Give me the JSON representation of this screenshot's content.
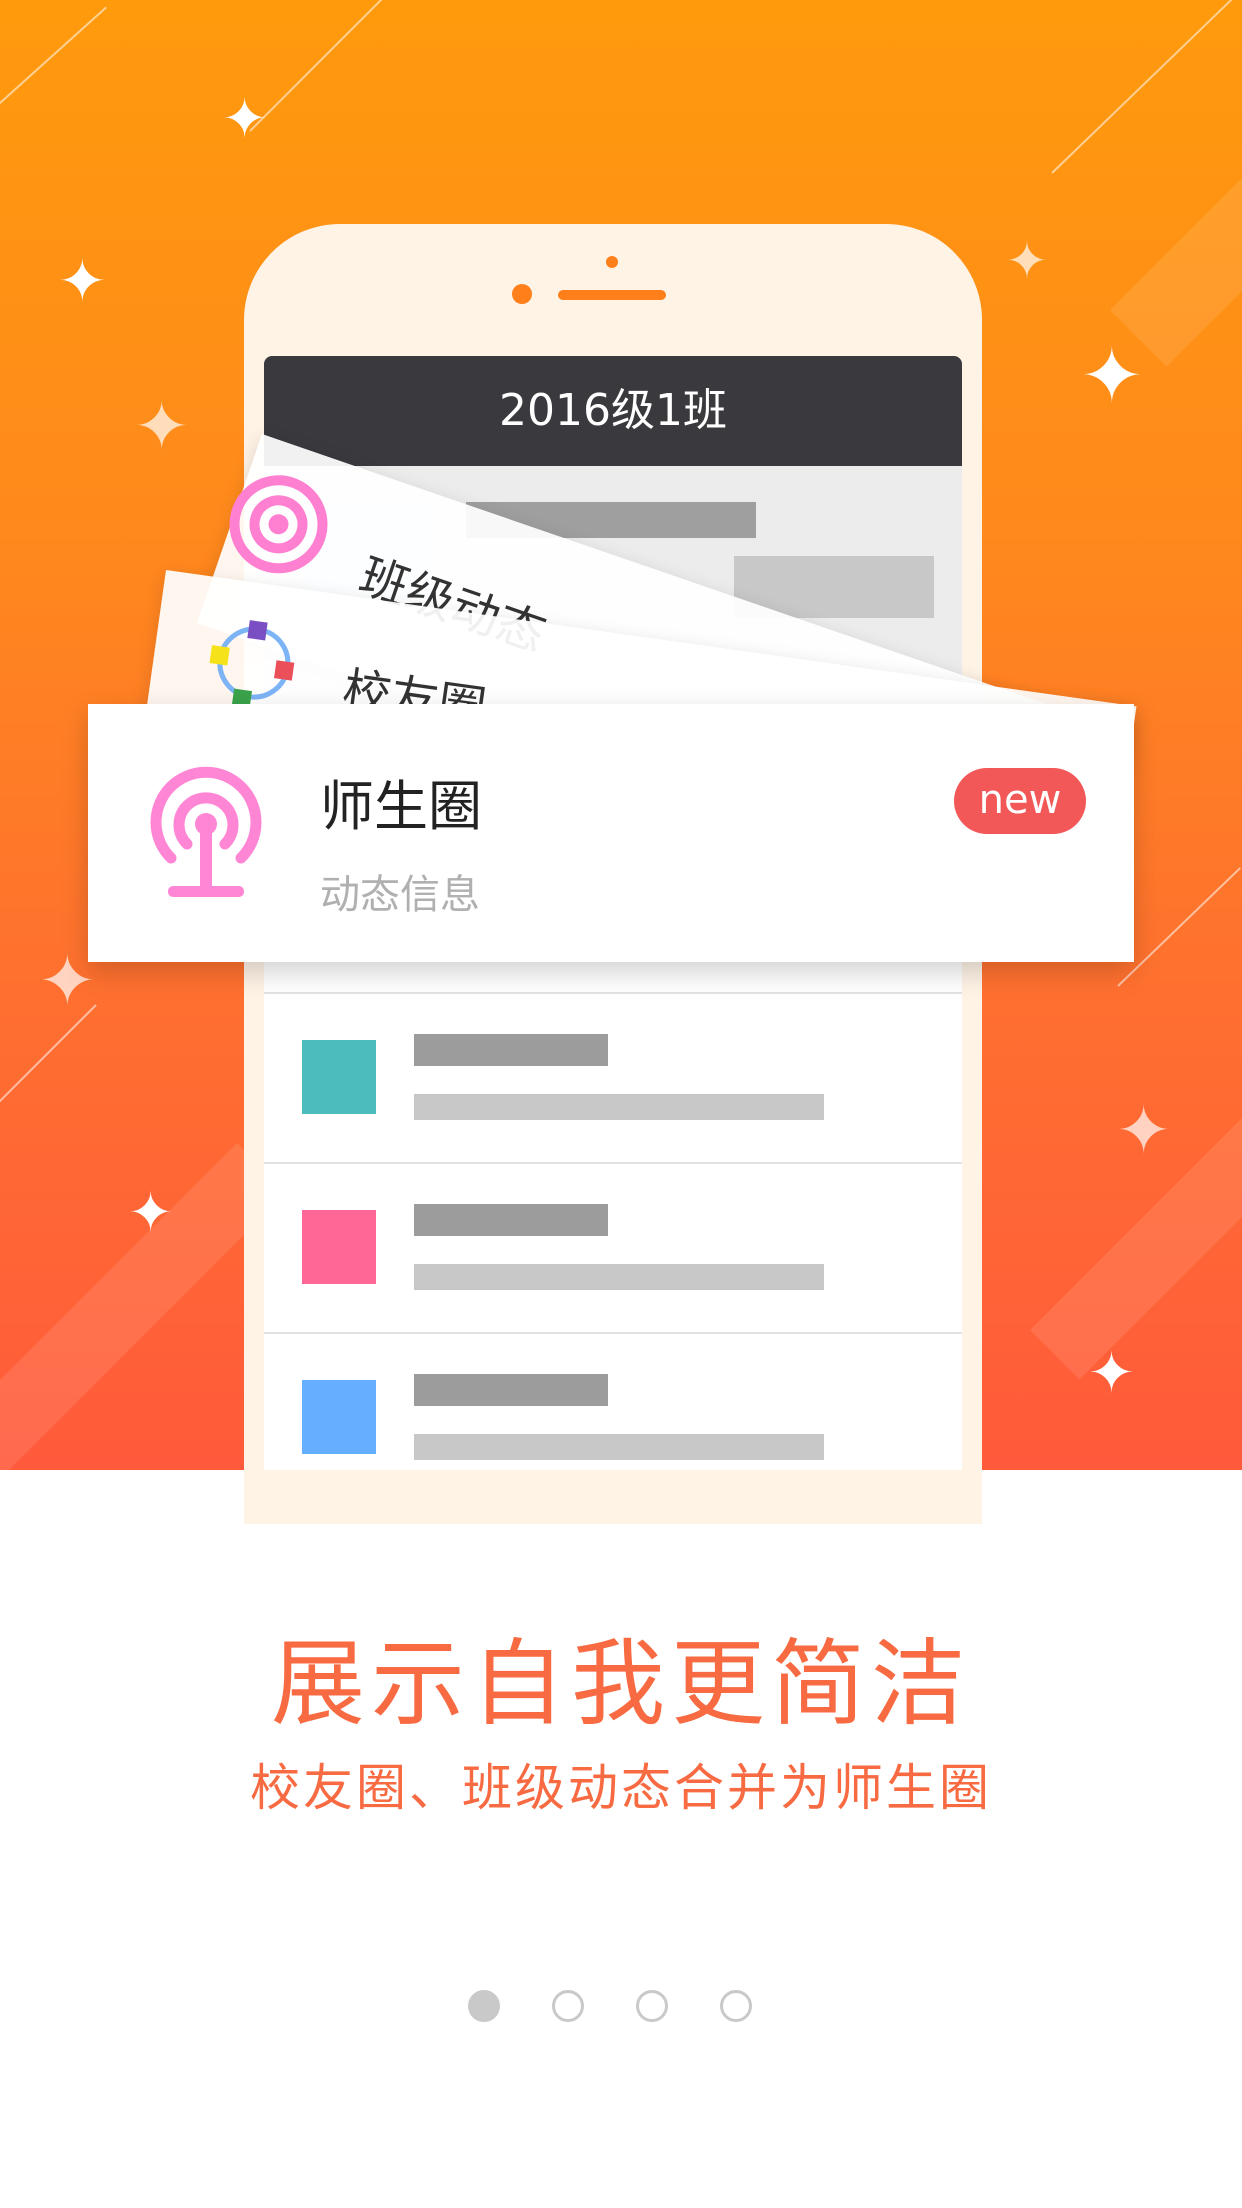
{
  "screen": {
    "class_title": "2016级1班"
  },
  "cards": {
    "back_card_label": "班级动态",
    "middle_card_label": "校友圈",
    "front_card": {
      "title": "师生圈",
      "subtitle": "动态信息",
      "badge": "new"
    }
  },
  "intro": {
    "headline": "展示自我更简洁",
    "subline": "校友圈、班级动态合并为师生圈"
  },
  "pagination": {
    "total": 4,
    "active_index": 0
  },
  "colors": {
    "hero_top": "#ff9a0c",
    "hero_bottom": "#ff5a3b",
    "accent_text": "#f76a42",
    "badge": "#f25858",
    "row_teal": "#4cbcbc",
    "row_pink": "#ff6896",
    "row_blue": "#66aeff"
  }
}
